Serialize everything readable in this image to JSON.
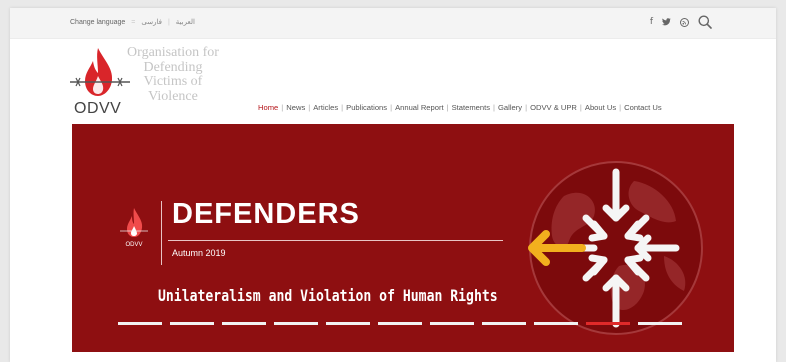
{
  "topbar": {
    "change_language": "Change language",
    "languages": [
      "فارسی",
      "العربیة"
    ]
  },
  "social": {
    "icons": [
      "facebook-icon",
      "twitter-icon",
      "rss-icon",
      "search-icon"
    ],
    "facebook_glyph": "f"
  },
  "logo": {
    "name_lines": [
      "Organisation for",
      "Defending",
      "Victims of",
      "Violence"
    ],
    "abbr": "ODVV"
  },
  "nav": {
    "items": [
      "Home",
      "News",
      "Articles",
      "Publications",
      "Annual Report",
      "Statements",
      "Gallery",
      "ODVV & UPR",
      "About Us",
      "Contact Us"
    ],
    "active": "Home"
  },
  "banner": {
    "logo_abbr": "ODVV",
    "title": "DEFENDERS",
    "season": "Autumn 2019",
    "subtitle": "Unilateralism and Violation of Human Rights",
    "colors": {
      "background": "#8e0f11",
      "arrow": "#f2b01e",
      "active_dash": "#e02a2a"
    },
    "slides": 11,
    "active_slide": 10
  }
}
